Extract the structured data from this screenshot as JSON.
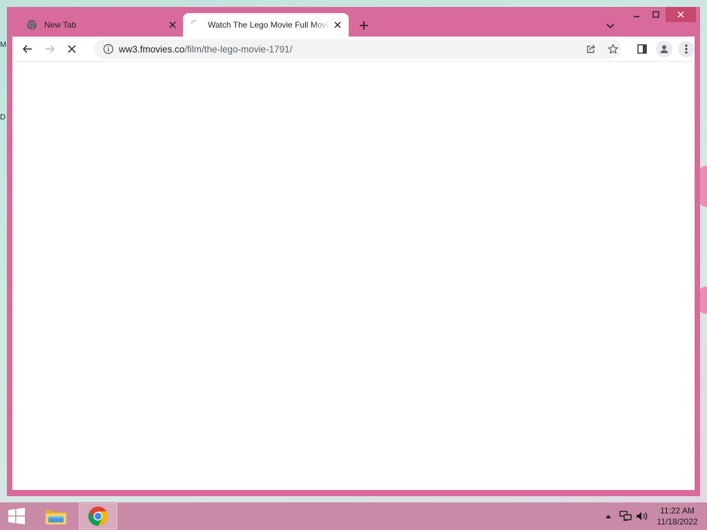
{
  "desktop": {
    "peek_top": "M",
    "peek_mid": "D"
  },
  "browser": {
    "tabs": [
      {
        "title": "New Tab",
        "favicon": "chrome-icon",
        "active": false
      },
      {
        "title": "Watch The Lego Movie Full Movie",
        "favicon": "loading-spinner-icon",
        "active": true
      }
    ],
    "address": {
      "host": "ww3.fmovies.co",
      "path": "/film/the-lego-movie-1791/"
    },
    "loading": true,
    "colors": {
      "frame": "#d96a9c",
      "close_hover": "#c74a6e",
      "toolbar": "#ffffff",
      "omnibox": "#f1f3f4"
    }
  },
  "taskbar": {
    "pinned": [
      "file-explorer-icon",
      "chrome-icon"
    ],
    "active_app": "chrome-icon",
    "clock": {
      "time": "11:22 AM",
      "date": "11/18/2022"
    },
    "colors": {
      "background": "#c88aa6"
    }
  }
}
